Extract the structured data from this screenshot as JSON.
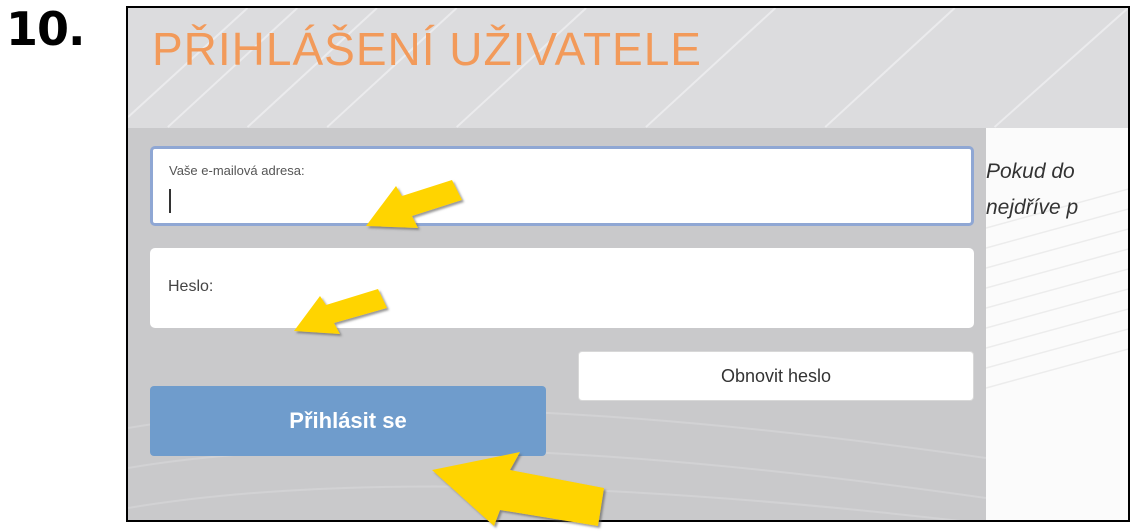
{
  "step": {
    "number": "10."
  },
  "page": {
    "title": "PŘIHLÁŠENÍ UŽIVATELE"
  },
  "form": {
    "email_label": "Vaše e-mailová adresa:",
    "password_label": "Heslo:",
    "reset_button": "Obnovit heslo",
    "login_button": "Přihlásit se"
  },
  "side": {
    "line1": "Pokud do",
    "line2": "nejdříve p"
  },
  "colors": {
    "title": "#f29a5a",
    "login_button": "#6f9ccc",
    "focus_border": "#8fa7d4",
    "arrow": "#ffd400"
  },
  "annotations": {
    "icon": "yellow-arrow-icon"
  }
}
